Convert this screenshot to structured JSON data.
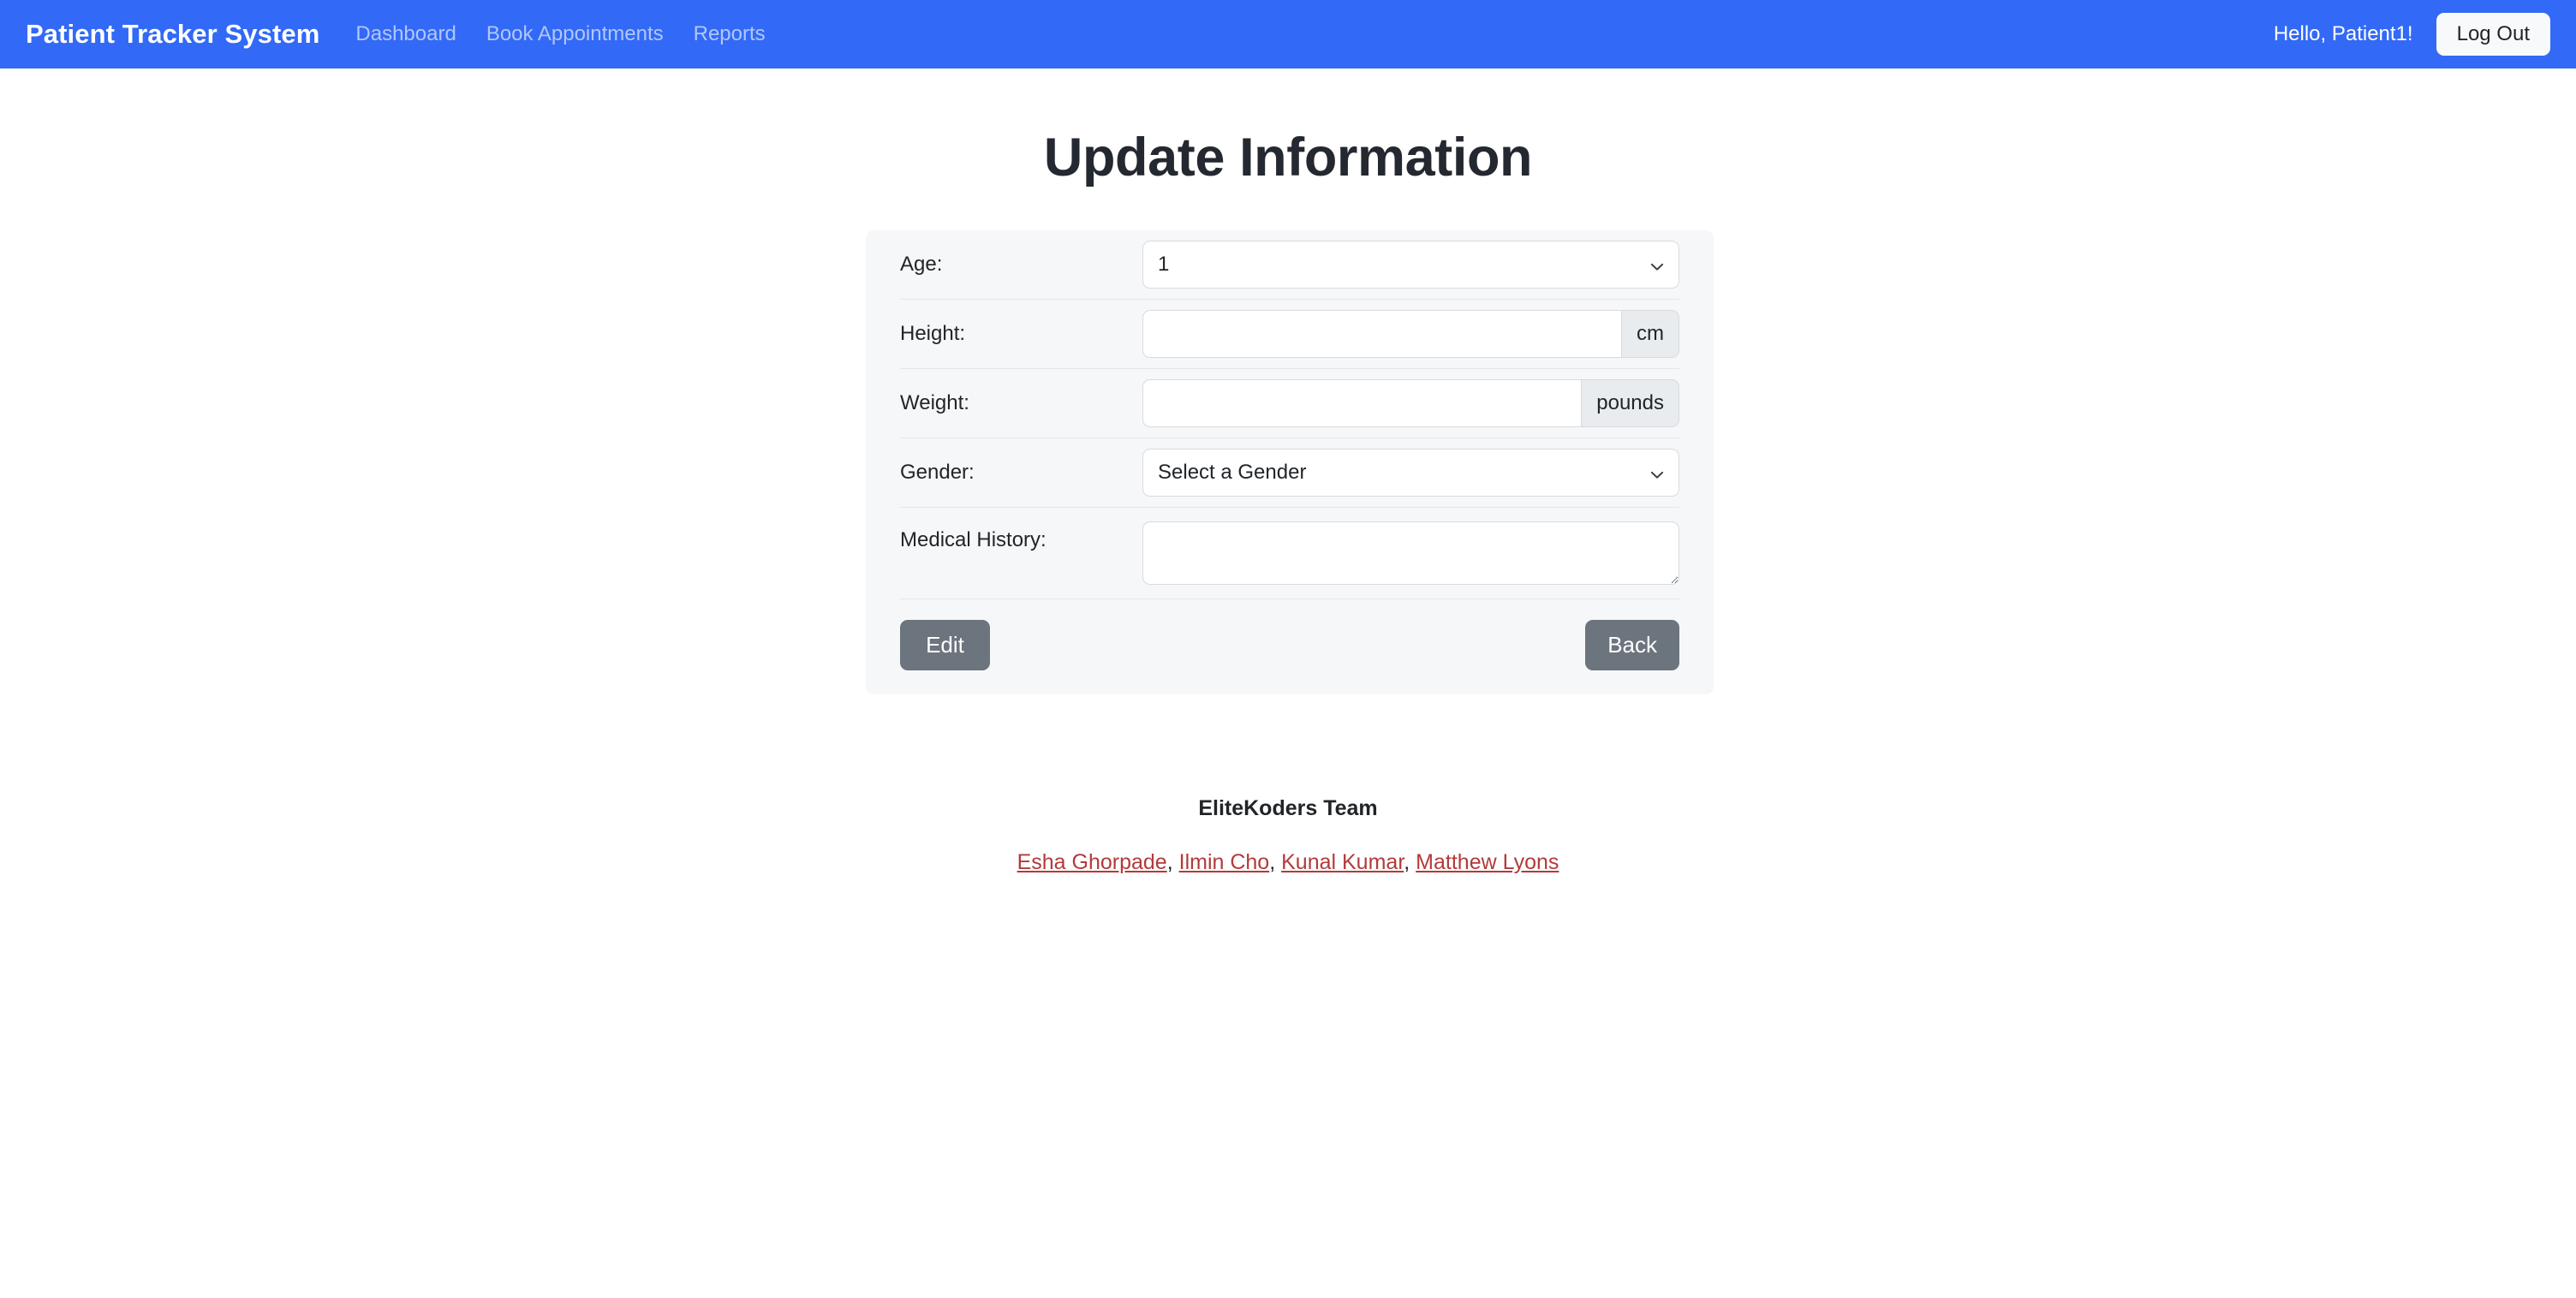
{
  "navbar": {
    "brand": "Patient Tracker System",
    "links": [
      {
        "label": "Dashboard",
        "name": "nav-link-dashboard"
      },
      {
        "label": "Book Appointments",
        "name": "nav-link-book-appointments"
      },
      {
        "label": "Reports",
        "name": "nav-link-reports"
      }
    ],
    "greeting": "Hello, Patient1!",
    "logout_label": "Log Out",
    "background_color": "#3269f6",
    "link_color": "#ffffffa0",
    "brand_color": "#ffffff"
  },
  "page": {
    "title": "Update Information",
    "background_color": "#ffffff",
    "card_background": "#f6f7f9"
  },
  "form": {
    "age": {
      "label": "Age:",
      "value": "1",
      "control": "select",
      "chevron_icon": "chevron-down-icon"
    },
    "height": {
      "label": "Height:",
      "value": "",
      "placeholder": "",
      "unit": "cm",
      "control": "input-group"
    },
    "weight": {
      "label": "Weight:",
      "value": "",
      "placeholder": "",
      "unit": "pounds",
      "control": "input-group"
    },
    "gender": {
      "label": "Gender:",
      "value": "Select a Gender",
      "control": "select",
      "chevron_icon": "chevron-down-icon"
    },
    "medical_history": {
      "label": "Medical History:",
      "value": "",
      "placeholder": "",
      "control": "textarea"
    },
    "actions": {
      "edit_label": "Edit",
      "back_label": "Back",
      "button_color": "#6c757d"
    }
  },
  "footer": {
    "team": "EliteKoders Team",
    "members": [
      {
        "name": "Esha Ghorpade"
      },
      {
        "name": "Ilmin Cho"
      },
      {
        "name": "Kunal Kumar"
      },
      {
        "name": "Matthew Lyons"
      }
    ],
    "separator": ", ",
    "link_color": "#b33a3a"
  }
}
